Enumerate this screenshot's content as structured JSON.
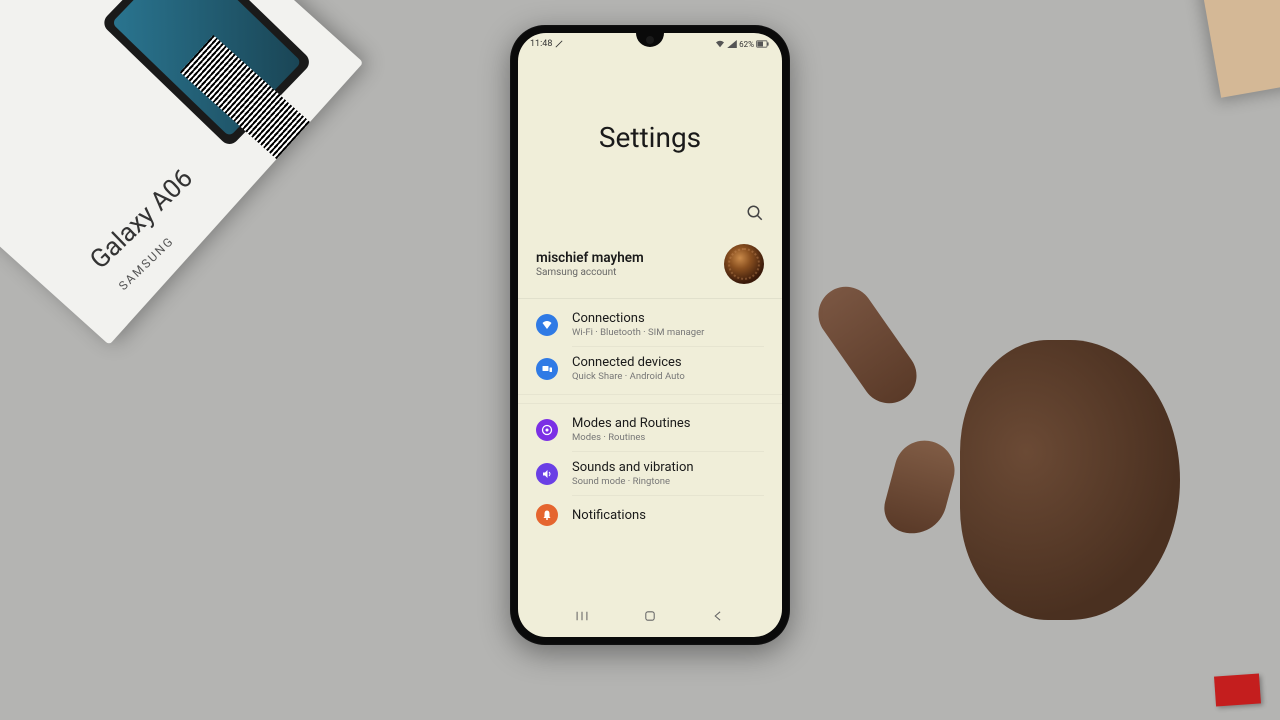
{
  "status": {
    "time": "11:48",
    "battery": "62%"
  },
  "header": {
    "title": "Settings"
  },
  "account": {
    "name": "mischief mayhem",
    "subtitle": "Samsung account"
  },
  "settings_items": [
    {
      "title": "Connections",
      "subtitle": "Wi-Fi · Bluetooth · SIM manager",
      "icon": "wifi",
      "color": "connections"
    },
    {
      "title": "Connected devices",
      "subtitle": "Quick Share · Android Auto",
      "icon": "devices",
      "color": "connected"
    },
    {
      "title": "Modes and Routines",
      "subtitle": "Modes · Routines",
      "icon": "modes",
      "color": "modes"
    },
    {
      "title": "Sounds and vibration",
      "subtitle": "Sound mode · Ringtone",
      "icon": "sounds",
      "color": "sounds"
    },
    {
      "title": "Notifications",
      "subtitle": "",
      "icon": "notifications",
      "color": "notifications"
    }
  ],
  "box": {
    "brand": "Galaxy A06",
    "maker": "SAMSUNG"
  }
}
